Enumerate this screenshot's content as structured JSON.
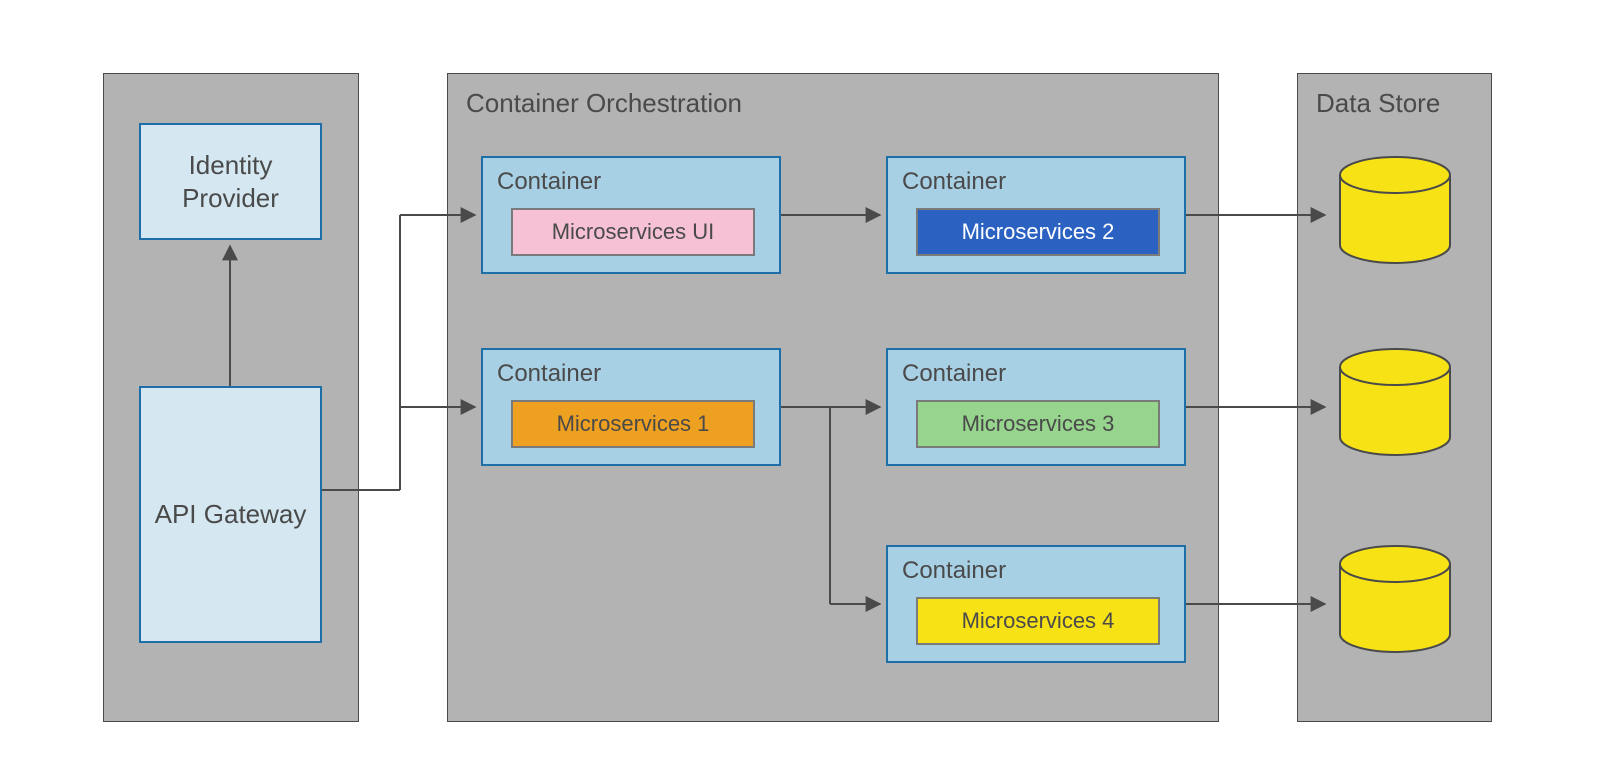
{
  "left_panel": {
    "identity_provider": "Identity\nProvider",
    "api_gateway": "API Gateway"
  },
  "orchestration": {
    "title": "Container Orchestration",
    "containers": [
      {
        "label": "Container",
        "ms_label": "Microservices UI",
        "ms_class": "ms-ui"
      },
      {
        "label": "Container",
        "ms_label": "Microservices  2",
        "ms_class": "ms-2"
      },
      {
        "label": "Container",
        "ms_label": "Microservices  1",
        "ms_class": "ms-1"
      },
      {
        "label": "Container",
        "ms_label": "Microservices  3",
        "ms_class": "ms-3"
      },
      {
        "label": "Container",
        "ms_label": "Microservices  4",
        "ms_class": "ms-4"
      }
    ]
  },
  "data_store": {
    "title": "Data Store"
  },
  "colors": {
    "panel_bg": "#b3b3b3",
    "box_bg": "#d5e8f2",
    "container_bg": "#a7d0e4",
    "db_fill": "#f7e216",
    "arrow": "#4a4a4a"
  }
}
